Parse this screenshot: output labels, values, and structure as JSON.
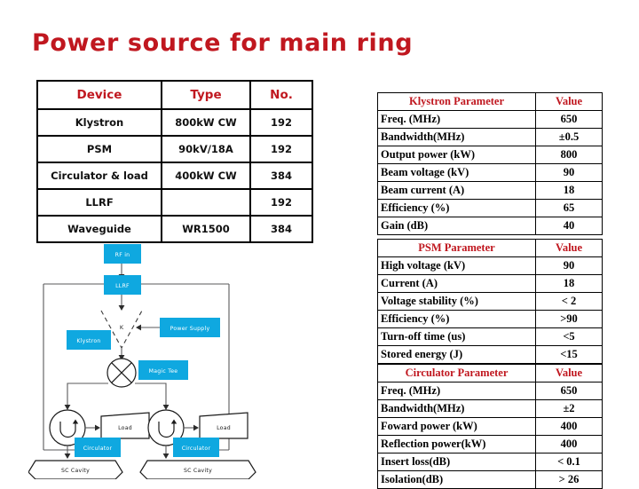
{
  "slide": {
    "title": "Power source for main ring",
    "title_color": "#c0171f",
    "accent_cyan": "#0fa8e0"
  },
  "device_table": {
    "name": "device-summary-table",
    "headers": [
      "Device",
      "Type",
      "No."
    ],
    "rows": [
      [
        "Klystron",
        "800kW CW",
        "192"
      ],
      [
        "PSM",
        "90kV/18A",
        "192"
      ],
      [
        "Circulator & load",
        "400kW CW",
        "384"
      ],
      [
        "LLRF",
        "",
        "192"
      ],
      [
        "Waveguide",
        "WR1500",
        "384"
      ]
    ]
  },
  "klystron_table": {
    "headers": [
      "Klystron Parameter",
      "Value"
    ],
    "rows": [
      [
        "Freq. (MHz)",
        "650"
      ],
      [
        "Bandwidth(MHz)",
        "±0.5"
      ],
      [
        "Output power (kW)",
        "800"
      ],
      [
        "Beam voltage (kV)",
        "90"
      ],
      [
        "Beam current (A)",
        "18"
      ],
      [
        "Efficiency (%)",
        "65"
      ],
      [
        "Gain (dB)",
        "40"
      ]
    ]
  },
  "psm_table": {
    "headers": [
      "PSM Parameter",
      "Value"
    ],
    "rows": [
      [
        "High voltage (kV)",
        "90"
      ],
      [
        "Current (A)",
        "18"
      ],
      [
        "Voltage stability (%)",
        "< 2"
      ],
      [
        "Efficiency (%)",
        ">90"
      ],
      [
        "Turn-off time (us)",
        "<5"
      ],
      [
        "Stored energy (J)",
        "<15"
      ]
    ]
  },
  "circulator_table": {
    "headers": [
      "Circulator Parameter",
      "Value"
    ],
    "rows": [
      [
        "Freq. (MHz)",
        "650"
      ],
      [
        "Bandwidth(MHz)",
        "±2"
      ],
      [
        "Foward power (kW)",
        "400"
      ],
      [
        "Reflection power(kW)",
        "400"
      ],
      [
        "Insert loss(dB)",
        "< 0.1"
      ],
      [
        "Isolation(dB)",
        "> 26"
      ]
    ]
  },
  "diagram": {
    "name": "rf-power-block-diagram",
    "labels": {
      "rf_in": "RF in",
      "llrf": "LLRF",
      "klystron": "Klystron",
      "klystron_symbol": "K",
      "power_supply": "Power Supply",
      "magic_tee": "Magic Tee",
      "circulator_left": "Circulator",
      "circulator_right": "Circulator",
      "load_left": "Load",
      "load_right": "Load",
      "cavity_left": "SC Cavity",
      "cavity_right": "SC Cavity"
    }
  }
}
